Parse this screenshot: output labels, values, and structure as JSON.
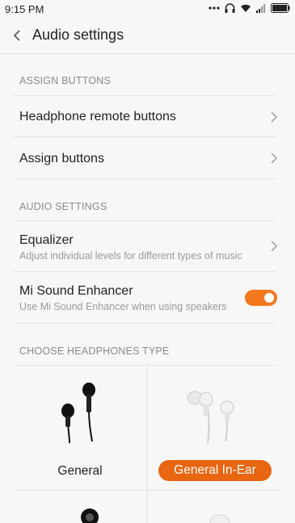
{
  "status_bar": {
    "time": "9:15 PM",
    "icons": [
      "more-dots-icon",
      "headphone-icon",
      "wifi-icon",
      "signal-icon",
      "battery-icon"
    ]
  },
  "header": {
    "title": "Audio settings",
    "back_icon": "back-chevron-icon"
  },
  "sections": {
    "assign_buttons": {
      "header": "ASSIGN BUTTONS",
      "items": [
        {
          "label": "Headphone remote buttons"
        },
        {
          "label": "Assign buttons"
        }
      ]
    },
    "audio_settings": {
      "header": "AUDIO SETTINGS",
      "equalizer": {
        "label": "Equalizer",
        "subtitle": "Adjust individual levels for different types of music"
      },
      "mi_sound": {
        "label": "Mi Sound Enhancer",
        "subtitle": "Use Mi Sound Enhancer when using speakers",
        "enabled": true
      }
    },
    "headphones_type": {
      "header": "CHOOSE HEADPHONES TYPE",
      "options": [
        {
          "label": "General",
          "selected": false
        },
        {
          "label": "General In-Ear",
          "selected": true
        }
      ]
    }
  },
  "colors": {
    "accent": "#f4781e",
    "selected_pill": "#e86511",
    "background": "#f7f7f7",
    "divider": "#e3e3e3"
  }
}
